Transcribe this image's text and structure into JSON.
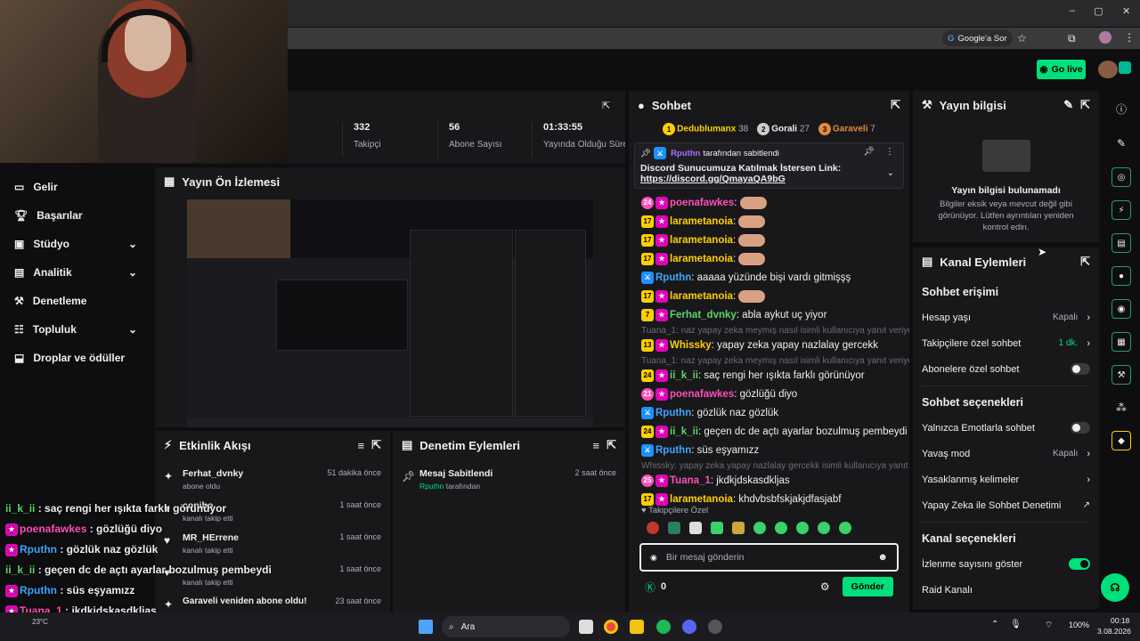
{
  "browser": {
    "google_sor": "Google'a Sor",
    "window_controls": [
      "–",
      "▢",
      "✕"
    ]
  },
  "topbar": {
    "go_live": "Go live"
  },
  "stats": [
    {
      "value": "332",
      "label": "Takipçi"
    },
    {
      "value": "56",
      "label": "Abone Sayısı"
    },
    {
      "value": "01:33:55",
      "label": "Yayında Olduğu Süre"
    }
  ],
  "sidebar": {
    "items": [
      {
        "label": "Gelir",
        "icon": "money-icon",
        "expand": false
      },
      {
        "label": "Başarılar",
        "icon": "trophy-icon",
        "expand": false
      },
      {
        "label": "Stüdyo",
        "icon": "studio-icon",
        "expand": true
      },
      {
        "label": "Analitik",
        "icon": "analytics-icon",
        "expand": true
      },
      {
        "label": "Denetleme",
        "icon": "wrench-icon",
        "expand": false
      },
      {
        "label": "Topluluk",
        "icon": "community-icon",
        "expand": true
      },
      {
        "label": "Droplar ve ödüller",
        "icon": "drops-icon",
        "expand": false
      }
    ]
  },
  "preview": {
    "title": "Yayın Ön İzlemesi"
  },
  "activity": {
    "title": "Etkinlik Akışı",
    "items": [
      {
        "user": "Ferhat_dvnky",
        "time": "51 dakika önce",
        "action": "abone oldu"
      },
      {
        "user": "conibo",
        "time": "1 saat önce",
        "action": "kanalı takip etti"
      },
      {
        "user": "MR_HErrene",
        "time": "1 saat önce",
        "action": "kanalı takip etti"
      },
      {
        "user": "",
        "time": "1 saat önce",
        "action": "kanalı takip etti"
      },
      {
        "user": "Garaveli veniden abone oldu!",
        "time": "23 saat önce",
        "action": ""
      }
    ]
  },
  "mod_actions": {
    "title": "Denetim Eylemleri",
    "items": [
      {
        "title": "Mesaj Sabitlendi",
        "time": "2 saat önce",
        "by": "Rputhn",
        "suffix": "tarafından"
      }
    ]
  },
  "chat": {
    "title": "Sohbet",
    "leaderboard": [
      {
        "rank": "1",
        "name": "Dedublumanx",
        "score": "38"
      },
      {
        "rank": "2",
        "name": "Gorali",
        "score": "27"
      },
      {
        "rank": "3",
        "name": "Garaveli",
        "score": "7"
      }
    ],
    "pinned": {
      "by": "Rputhn",
      "by_suffix": "tarafından sabitlendi",
      "text": "Discord Sunucumuza Katılmak İstersen Link:",
      "link": "https://discord.gg/QmayaQA9bG"
    },
    "messages": [
      {
        "reply": "",
        "badge": "24",
        "user": "poenafawkes",
        "color": "u-pink",
        "text": "",
        "emote": true
      },
      {
        "reply": "",
        "badge": "17",
        "user": "larametanoia",
        "color": "u-yellow",
        "text": "",
        "emote": true
      },
      {
        "reply": "",
        "badge": "17",
        "user": "larametanoia",
        "color": "u-yellow",
        "text": "",
        "emote": true
      },
      {
        "reply": "",
        "badge": "17",
        "user": "larametanoia",
        "color": "u-yellow",
        "text": "",
        "emote": true
      },
      {
        "reply": "",
        "badge": "",
        "user": "Rputhn",
        "color": "u-blue",
        "text": "aaaaa yüzünde bişi vardı gitmişşş",
        "emote": false
      },
      {
        "reply": "",
        "badge": "17",
        "user": "larametanoia",
        "color": "u-yellow",
        "text": "",
        "emote": true
      },
      {
        "reply": "",
        "badge": "7",
        "user": "Ferhat_dvnky",
        "color": "u-green",
        "text": "abla aykut uç yiyor",
        "emote": false
      },
      {
        "reply": "Tuana_1: naz yapay zeka meymış nasıl isimli kullanıcıya yanıt veriyor",
        "badge": "13",
        "user": "Whissky",
        "color": "u-yellow",
        "text": "yapay zeka yapay nazlalay gercekk",
        "emote": false
      },
      {
        "reply": "Tuana_1: naz yapay zeka meymış nasıl isimli kullanıcıya yanıt veriyor",
        "badge": "24",
        "user": "ii_k_ii",
        "color": "u-green",
        "text": "saç rengi her ışıkta farklı görünüyor",
        "emote": false
      },
      {
        "reply": "",
        "badge": "21",
        "user": "poenafawkes",
        "color": "u-pink",
        "text": "gözlüğü diyo",
        "emote": false
      },
      {
        "reply": "",
        "badge": "",
        "user": "Rputhn",
        "color": "u-blue",
        "text": "gözlük naz gözlük",
        "emote": false
      },
      {
        "reply": "",
        "badge": "24",
        "user": "ii_k_ii",
        "color": "u-green",
        "text": "geçen dc de açtı ayarlar bozulmuş pembeydi",
        "emote": false
      },
      {
        "reply": "",
        "badge": "",
        "user": "Rputhn",
        "color": "u-blue",
        "text": "süs eşyamızz",
        "emote": false
      },
      {
        "reply": "Whissky: yapay zeka yapay nazlalay gercekk isimli kullanıcıya yanıt ve...",
        "badge": "25",
        "user": "Tuana_1",
        "color": "u-pink",
        "text": "jkdkjdskasdkljas",
        "emote": false
      },
      {
        "reply": "",
        "badge": "17",
        "user": "larametanoia",
        "color": "u-yellow",
        "text": "khdvbsbfskjakjdfasjabf",
        "emote": false
      }
    ],
    "followers_only": "Takipçilere Özel",
    "input_placeholder": "Bir mesaj gönderin",
    "points": "0",
    "send": "Gönder"
  },
  "stream_info": {
    "title": "Yayın bilgisi",
    "empty_title": "Yayın bilgisi bulunamadı",
    "empty_text": "Bilgiler eksik veya mevcut değil gibi görünüyor. Lütfen ayrıntıları yeniden kontrol edin."
  },
  "channel_actions": {
    "title": "Kanal Eylemleri",
    "chat_access": "Sohbet erişimi",
    "account_age": "Hesap yaşı",
    "account_age_value": "Kapalı",
    "followers_chat": "Takipçilere özel sohbet",
    "followers_chat_value": "1 dk.",
    "subs_chat": "Abonelere özel sohbet",
    "chat_options": "Sohbet seçenekleri",
    "emote_only": "Yalnızca Emotlarla sohbet",
    "slow_mode": "Yavaş mod",
    "slow_mode_value": "Kapalı",
    "banned_words": "Yasaklanmış kelimeler",
    "ai_mod": "Yapay Zeka ile Sohbet Denetimi",
    "channel_options": "Kanal seçenekleri",
    "show_viewers": "İzlenme sayısını göster",
    "raid": "Raid Kanalı"
  },
  "overlay_chat": [
    {
      "user": "ii_k_ii",
      "color": "u-green",
      "text": "saç rengi her ışıkta farklı görünüyor",
      "badge": false
    },
    {
      "user": "poenafawkes",
      "color": "u-pink",
      "text": "gözlüğü diyo",
      "badge": true
    },
    {
      "user": "Rputhn",
      "color": "u-blue",
      "text": "gözlük naz gözlük",
      "badge": true
    },
    {
      "user": "ii_k_ii",
      "color": "u-green",
      "text": "geçen dc de açtı ayarlar bozulmuş pembeydi",
      "badge": false
    },
    {
      "user": "Rputhn",
      "color": "u-blue",
      "text": "süs eşyamızz",
      "badge": true
    },
    {
      "user": "Tuana_1",
      "color": "u-pink",
      "text": "jkdkjdskasdkljas",
      "badge": true
    },
    {
      "user": "larametanoia",
      "color": "u-yellow",
      "text": "khdvbsbfskjakjdfasjabf",
      "badge": false
    }
  ],
  "taskbar": {
    "search": "Ara",
    "weather": "23°C",
    "battery": "100%",
    "time": "00:18",
    "date": "3.08.2026"
  }
}
